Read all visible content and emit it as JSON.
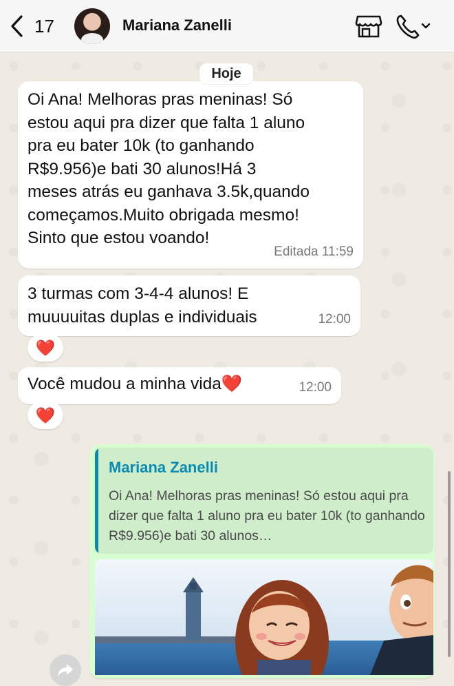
{
  "header": {
    "back_count": "17",
    "contact_name": "Mariana Zanelli",
    "icons": [
      "chevron-left-icon",
      "store-icon",
      "phone-icon",
      "chevron-down-icon"
    ]
  },
  "date_label": "Hoje",
  "messages": [
    {
      "text": "Oi Ana! Melhoras pras meninas! Só\nestou aqui pra dizer que falta 1 aluno\npra eu bater 10k (to ganhando\nR$9.956)e bati 30 alunos!Há 3\nmeses atrás eu ganhava 3.5k,quando\ncomeçamos.Muito obrigada mesmo!\nSinto que estou voando!",
      "meta": "Editada 11:59"
    },
    {
      "text": "3 turmas com 3-4-4 alunos! E\nmuuuuitas duplas e individuais",
      "meta": "12:00",
      "reaction": "❤️"
    },
    {
      "text": "Você mudou a minha vida❤️",
      "meta": "12:00",
      "reaction": "❤️"
    }
  ],
  "reply": {
    "quoted_name": "Mariana Zanelli",
    "quoted_text": "Oi Ana! Melhoras pras meninas! Só estou aqui pra dizer que falta 1 aluno pra eu bater 10k (to ganhando R$9.956)e bati 30 alunos…"
  },
  "colors": {
    "incoming_bubble": "#ffffff",
    "outgoing_bubble": "#d9fdd3",
    "quote_accent": "#0a8aa0",
    "heart": "#e0202e"
  }
}
